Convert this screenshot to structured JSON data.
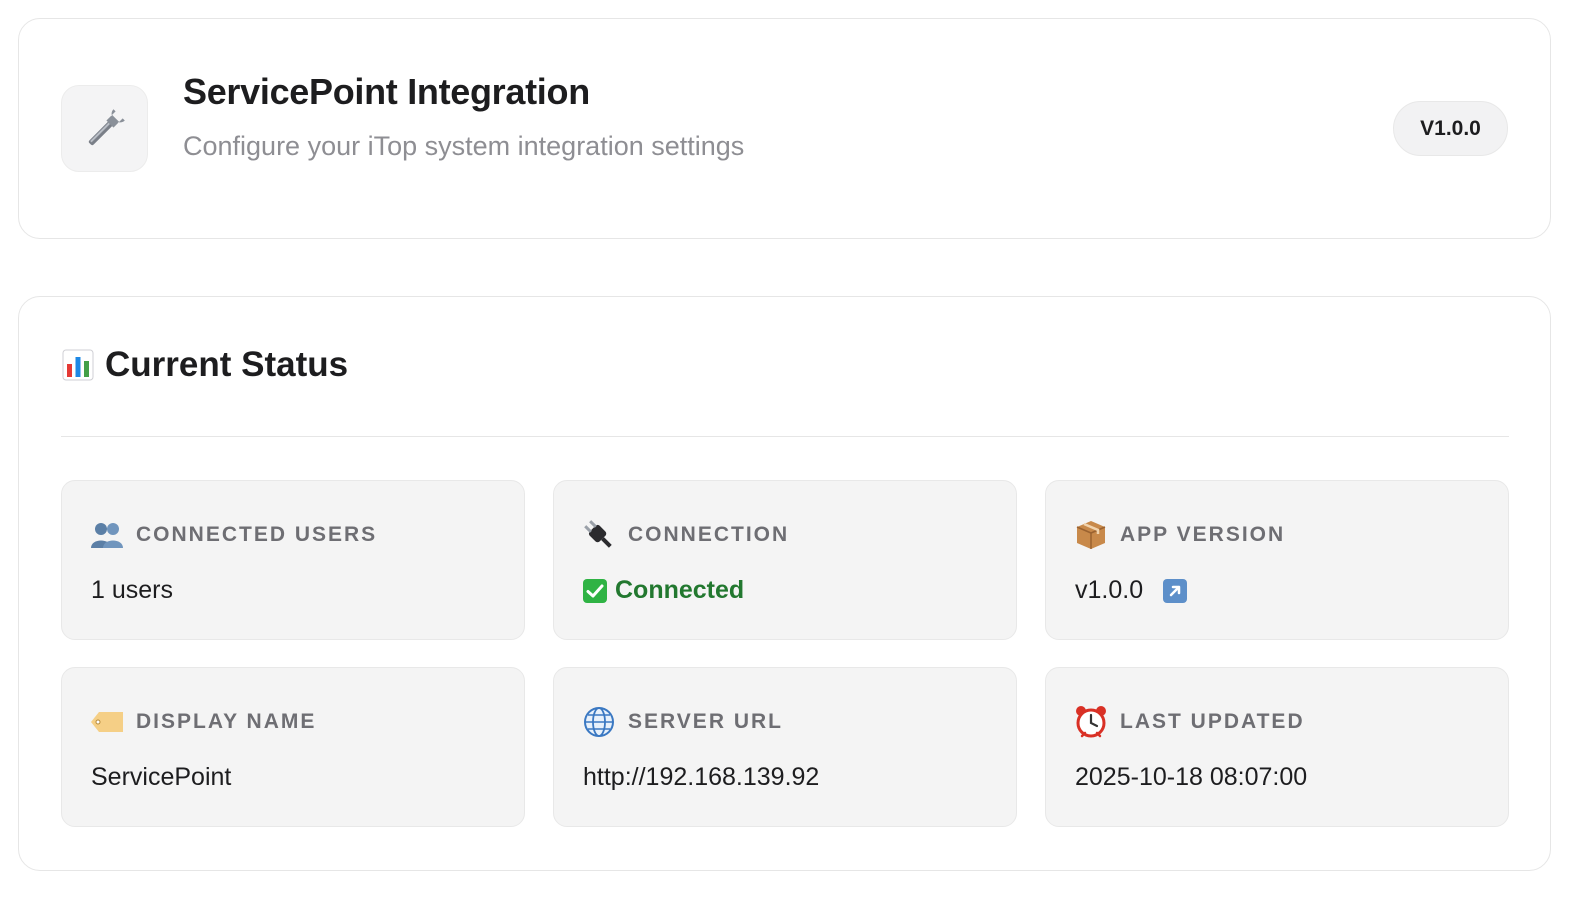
{
  "header": {
    "icon": "wrench-icon",
    "title": "ServicePoint Integration",
    "subtitle": "Configure your iTop system integration settings",
    "version_badge": "V1.0.0"
  },
  "status": {
    "icon": "bar-chart-icon",
    "title": "Current Status",
    "tiles": [
      {
        "icon": "users-icon",
        "label": "CONNECTED USERS",
        "value": "1 users"
      },
      {
        "icon": "plug-icon",
        "label": "CONNECTION",
        "value": "Connected",
        "value_icon": "check-box-icon",
        "value_color": "#22782f"
      },
      {
        "icon": "package-icon",
        "label": "APP VERSION",
        "value": "v1.0.0",
        "value_icon": "external-link-icon"
      },
      {
        "icon": "tag-icon",
        "label": "DISPLAY NAME",
        "value": "ServicePoint"
      },
      {
        "icon": "globe-icon",
        "label": "SERVER URL",
        "value": "http://192.168.139.92"
      },
      {
        "icon": "alarm-clock-icon",
        "label": "LAST UPDATED",
        "value": "2025-10-18 08:07:00"
      }
    ]
  }
}
